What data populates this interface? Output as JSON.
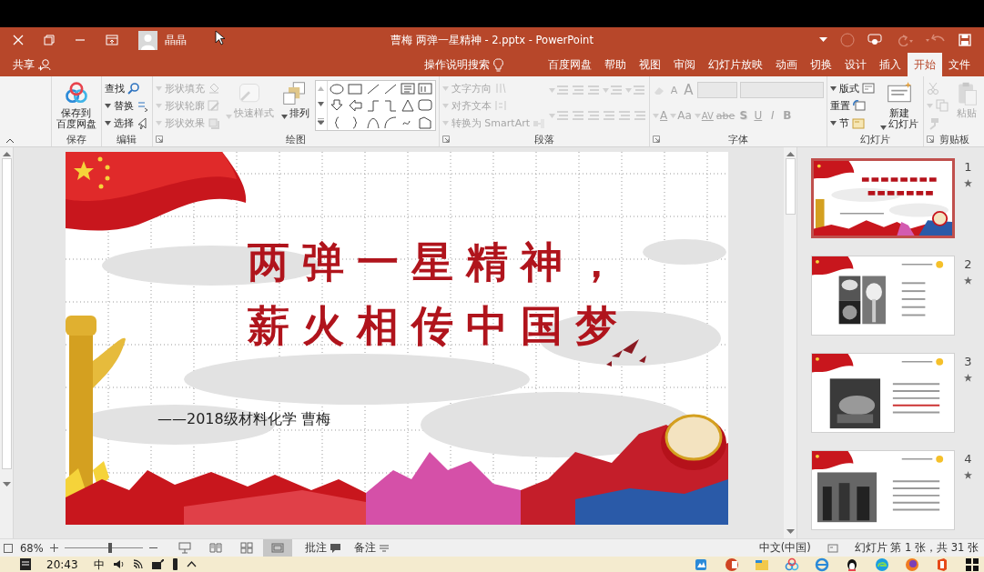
{
  "title_bar": {
    "title": "曹梅 两弹一星精神 - 2.pptx - PowerPoint",
    "user": "晶晶"
  },
  "share": "共享",
  "tell_me": "操作说明搜索",
  "tabs": [
    {
      "label": "百度网盘",
      "selected": false
    },
    {
      "label": "帮助",
      "selected": false
    },
    {
      "label": "视图",
      "selected": false
    },
    {
      "label": "审阅",
      "selected": false
    },
    {
      "label": "幻灯片放映",
      "selected": false
    },
    {
      "label": "动画",
      "selected": false
    },
    {
      "label": "切换",
      "selected": false
    },
    {
      "label": "设计",
      "selected": false
    },
    {
      "label": "插入",
      "selected": false
    },
    {
      "label": "开始",
      "selected": true
    },
    {
      "label": "文件",
      "selected": false
    }
  ],
  "ribbon_groups": [
    {
      "label": "保存",
      "launcher": false,
      "items": [
        {
          "kind": "large",
          "lines": [
            "保存到",
            "百度网盘"
          ],
          "menu": false,
          "disabled": false
        }
      ]
    },
    {
      "label": "编辑",
      "launcher": false,
      "items": [
        {
          "kind": "stack",
          "items": [
            {
              "label": "查找",
              "menu": false,
              "disabled": false
            },
            {
              "label": "替换",
              "menu": true,
              "disabled": false
            },
            {
              "label": "选择",
              "menu": true,
              "disabled": false
            }
          ]
        }
      ]
    },
    {
      "label": "绘图",
      "launcher": true,
      "items": [
        {
          "kind": "stack",
          "items": [
            {
              "label": "形状填充",
              "menu": true,
              "disabled": true
            },
            {
              "label": "形状轮廓",
              "menu": true,
              "disabled": true
            },
            {
              "label": "形状效果",
              "menu": true,
              "disabled": true
            }
          ]
        },
        {
          "kind": "large",
          "lines": [
            "快速样式"
          ],
          "menu": true,
          "disabled": true
        },
        {
          "kind": "large",
          "lines": [
            "排列"
          ],
          "menu": true,
          "disabled": false
        },
        {
          "kind": "gallery"
        }
      ]
    },
    {
      "label": "段落",
      "launcher": true,
      "items": [
        {
          "kind": "stack",
          "items": [
            {
              "label": "文字方向",
              "menu": true,
              "disabled": true
            },
            {
              "label": "对齐文本",
              "menu": true,
              "disabled": true
            },
            {
              "label": "转换为 SmartArt",
              "menu": true,
              "disabled": true
            }
          ]
        },
        {
          "kind": "rows",
          "top": [
            {
              "kind": "icon",
              "menu": true,
              "disabled": true
            },
            {
              "kind": "icon",
              "menu": false,
              "disabled": true
            },
            {
              "kind": "icon",
              "menu": false,
              "disabled": true
            },
            {
              "kind": "icon",
              "menu": true,
              "disabled": true
            },
            {
              "kind": "icon",
              "menu": true,
              "disabled": true
            }
          ],
          "bottom": [
            {
              "kind": "icon",
              "menu": true,
              "disabled": true
            },
            {
              "kind": "icon",
              "menu": false,
              "disabled": true
            },
            {
              "kind": "icon",
              "menu": false,
              "disabled": true
            },
            {
              "kind": "icon",
              "menu": false,
              "disabled": true
            },
            {
              "kind": "icon",
              "menu": false,
              "disabled": true
            },
            {
              "kind": "icon",
              "menu": false,
              "disabled": true
            }
          ]
        }
      ]
    },
    {
      "label": "字体",
      "launcher": true,
      "items": [
        {
          "kind": "rows",
          "top": [
            {
              "kind": "icon",
              "menu": false,
              "disabled": true
            },
            {
              "kind": "text",
              "label": "A",
              "menu": false,
              "disabled": true
            },
            {
              "kind": "text",
              "label": "A",
              "menu": false,
              "disabled": true
            },
            {
              "kind": "field",
              "disabled": true
            },
            {
              "kind": "field",
              "disabled": true
            }
          ],
          "bottom": [
            {
              "kind": "text",
              "label": "A",
              "menu": true,
              "disabled": true
            },
            {
              "kind": "text",
              "label": "Aa",
              "menu": true,
              "disabled": true
            },
            {
              "kind": "text",
              "label": "AV",
              "menu": true,
              "disabled": true
            },
            {
              "kind": "text",
              "label": "abe",
              "menu": false,
              "disabled": true
            },
            {
              "kind": "text",
              "label": "S",
              "menu": false,
              "disabled": true
            },
            {
              "kind": "text",
              "label": "U",
              "menu": false,
              "disabled": true
            },
            {
              "kind": "text",
              "label": "I",
              "menu": false,
              "disabled": true
            },
            {
              "kind": "text",
              "label": "B",
              "menu": false,
              "disabled": true
            }
          ]
        }
      ]
    },
    {
      "label": "幻灯片",
      "launcher": false,
      "items": [
        {
          "kind": "stack",
          "items": [
            {
              "label": "版式",
              "menu": true,
              "disabled": false
            },
            {
              "label": "重置",
              "menu": false,
              "disabled": false
            },
            {
              "label": "节",
              "menu": true,
              "disabled": false
            }
          ]
        },
        {
          "kind": "large",
          "lines": [
            "新建",
            "幻灯片"
          ],
          "menu": true,
          "disabled": false
        }
      ]
    },
    {
      "label": "剪贴板",
      "launcher": true,
      "items": [
        {
          "kind": "stack",
          "items": [
            {
              "menu": false,
              "disabled": true
            },
            {
              "menu": true,
              "disabled": true
            },
            {
              "menu": false,
              "disabled": true
            }
          ]
        },
        {
          "kind": "large",
          "lines": [
            "粘贴"
          ],
          "menu": false,
          "disabled": true
        }
      ]
    }
  ],
  "slide": {
    "title_lines": [
      "两弹一星精神，",
      "薪火相传中国梦"
    ],
    "subtitle": "——2018级材料化学 曹梅"
  },
  "thumbnails": [
    {
      "number": "1",
      "selected": true
    },
    {
      "number": "2",
      "selected": false
    },
    {
      "number": "3",
      "selected": false
    },
    {
      "number": "4",
      "selected": false
    }
  ],
  "status_bar": {
    "zoom": "68%",
    "views": [
      {
        "selected": false
      },
      {
        "selected": false
      },
      {
        "selected": false
      },
      {
        "selected": true
      }
    ],
    "comments": "批注",
    "notes": "备注",
    "language": "中文(中国)",
    "slide_info": "幻灯片 第 1 张，共 31 张"
  },
  "taskbar": {
    "time": "20:43",
    "ime": "中"
  }
}
